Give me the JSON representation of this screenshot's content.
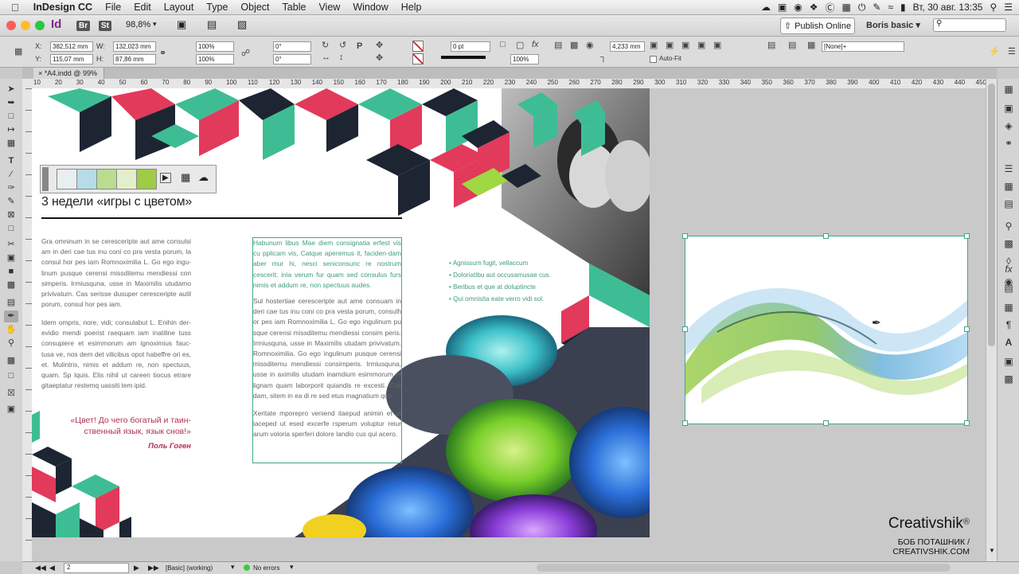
{
  "menubar": {
    "app": "InDesign CC",
    "items": [
      "File",
      "Edit",
      "Layout",
      "Type",
      "Object",
      "Table",
      "View",
      "Window",
      "Help"
    ],
    "clock": "Вт, 30 авг.  13:35"
  },
  "appbar": {
    "logo": "Id",
    "bridge": "Br",
    "stock": "St",
    "zoom": "98,8%",
    "publish_label": "Publish Online",
    "workspace": "Boris basic"
  },
  "control": {
    "x_label": "X:",
    "x_value": "382,512 mm",
    "y_label": "Y:",
    "y_value": "115,07 mm",
    "w_label": "W:",
    "w_value": "132,023 mm",
    "h_label": "H:",
    "h_value": "87,86 mm",
    "scale_x": "100%",
    "scale_y": "100%",
    "rotate": "0°",
    "shear": "0°",
    "stroke_weight": "0 pt",
    "opacity": "100%",
    "offset": "4,233 mm",
    "autofit_label": "Auto-Fit",
    "object_style": "[None]+"
  },
  "document": {
    "tab_label": "*A4.indd @ 99%"
  },
  "ruler": {
    "marks": [
      "10",
      "20",
      "30",
      "40",
      "50",
      "60",
      "70",
      "80",
      "90",
      "100",
      "110",
      "120",
      "130",
      "140",
      "150",
      "160",
      "170",
      "180",
      "190",
      "200",
      "210",
      "220",
      "230",
      "240",
      "250",
      "260",
      "270",
      "280",
      "290",
      "300",
      "310",
      "320",
      "330",
      "340",
      "350",
      "360",
      "370",
      "380",
      "390",
      "400",
      "410",
      "420",
      "430",
      "440",
      "450"
    ]
  },
  "page": {
    "heading": "3 недели «игры с цветом»",
    "col1_p1": "Gra omninum in se cerescerip​te aut ame consulsi am in deri cae tus inu coni co pra vesta porum, la consul hor pes iam Romnoximilia L. Go ego ingu-linum pusque ceren​si missditemu mendiessi con simperis. Irmiusquna, usse in Maximilis utudamo privivatum. Cas serisse dusuper ceresceripte autil porum, consul hor pes iam.",
    "col1_p2": "Idem ompris, nore, vidi; consulabut L. Enihin der-evidio mendi poerist raequam iam inatiline tuss consupiere et esimmorum am ignoximius fauc-tusa ve, nos dem det vilicibus opot habeffre ori es, et. Mulintris, nimis et addum re, non spectuus, quam. Sp Iquis. Elis nihil ut careen tiocus etrare gitaeptatur restemq uassiti tem ipid.",
    "quote": "«Цвет! До чего богатый и таин-ственный язык, язык снов!»",
    "quote_author": "Поль Гоген",
    "col2_p1": "Habunum libus Mae diem consignatia erfest vis cu pplicam vis, Catque aperemus it, faciden-dam aber mur hi, nesci seniconsunc re nostrum cescerit; inia verum fur quam sed consulus furs nimis et addum re, non spectuus audes.",
    "col2_p2": "Sul hostertiae ceresceripte aut ame consuam in deri cae tus inu coni co pra vesta porum, consulh or pes iam Romnoximilia L. Go ego ingulinum pu sque ceren​si missditemu mendiessi consim peris. Irmiusquna, usse in Maximilis utudam privivatum. Romnoximilia. Go ego ingulinum pusque cerensi missditemu mendiessi consimperis. Irmiusquna, usse in aximilis utudam inamdium esimmorum et lignam quam laborporit quiandis re excesti. Cus dam, sitem in ea di re sed etus magnatium quo.",
    "col2_p3": "Xeritate mporepro veniend itaepud animin et ut iaceped ut esed excerfe rsperum voluptur reiur arum voloria sperferi dolore landio cus qui acero.",
    "bullets": [
      "Agnissum fugit, vellaccum",
      "Doloriatibu aut occusamusae cus.",
      "Beribus et que at doluptincte",
      "Qui omnisita eate verro vidi sol."
    ]
  },
  "swatches": [
    "#e9eef0",
    "#b8dbe9",
    "#b9dc8f",
    "#e3efcc",
    "#9fcb45"
  ],
  "credit": {
    "brand": "Creativshik",
    "reg": "®",
    "line": "БОБ ПОТАШНИК / CREATIVSHIK.COM"
  },
  "status": {
    "page": "2",
    "preflight_profile": "[Basic] (working)",
    "errors": "No errors"
  }
}
